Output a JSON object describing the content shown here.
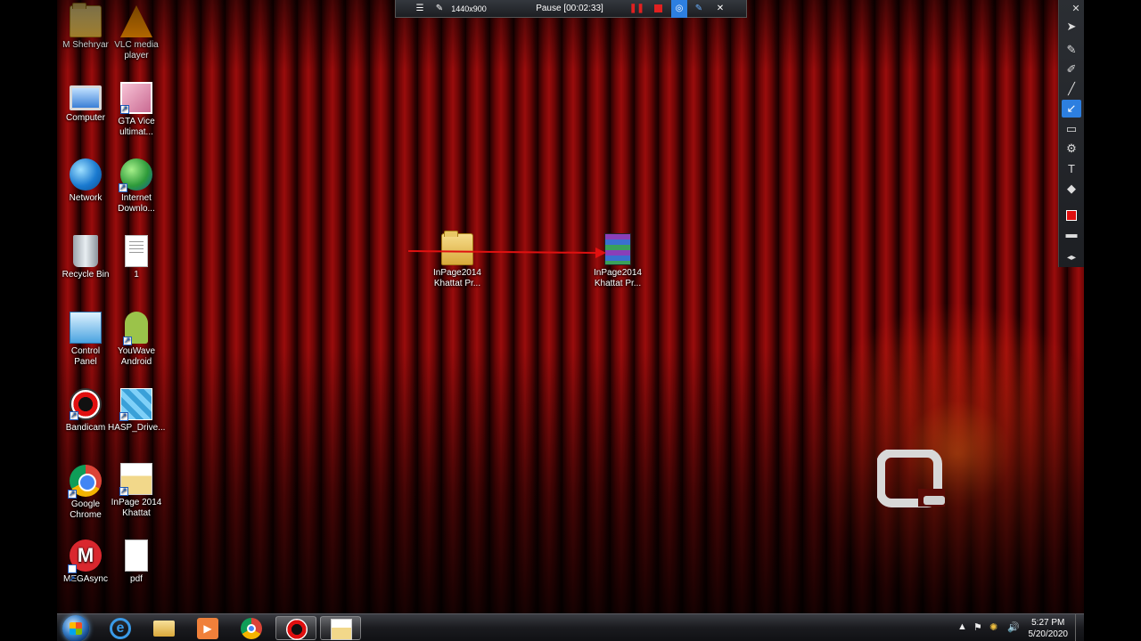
{
  "recorder": {
    "resolution": "1440x900",
    "status": "Pause [00:02:33]",
    "menu_icon": "hamburger-icon",
    "pin_icon": "pin-icon"
  },
  "desktop": {
    "icons_left": [
      {
        "label": "M Shehryar",
        "icon": "user-folder-icon"
      },
      {
        "label": "Computer",
        "icon": "computer-icon"
      },
      {
        "label": "Network",
        "icon": "network-icon"
      },
      {
        "label": "Recycle Bin",
        "icon": "recycle-bin-icon"
      },
      {
        "label": "Control\nPanel",
        "icon": "control-panel-icon"
      },
      {
        "label": "Bandicam",
        "icon": "bandicam-icon"
      },
      {
        "label": "Google\nChrome",
        "icon": "chrome-icon"
      },
      {
        "label": "MEGAsync",
        "icon": "mega-icon"
      }
    ],
    "icons_right": [
      {
        "label": "VLC media\nplayer",
        "icon": "vlc-icon"
      },
      {
        "label": "GTA Vice\nultimat...",
        "icon": "gta-icon"
      },
      {
        "label": "Internet\nDownlo...",
        "icon": "idm-icon"
      },
      {
        "label": "1",
        "icon": "text-document-icon"
      },
      {
        "label": "YouWave\nAndroid",
        "icon": "android-icon"
      },
      {
        "label": "HASP_Drive...",
        "icon": "hasp-icon"
      },
      {
        "label": "InPage 2014\nKhattat",
        "icon": "inpage-icon"
      },
      {
        "label": "pdf",
        "icon": "pdf-document-icon"
      }
    ],
    "center_folder": {
      "label": "InPage2014\nKhattat Pr...",
      "icon": "folder-icon"
    },
    "center_archive": {
      "label": "InPage2014\nKhattat Pr...",
      "icon": "winrar-archive-icon"
    }
  },
  "annotation": {
    "color": "#e01010"
  },
  "draw_tools": [
    "cursor-icon",
    "pen-icon",
    "highlighter-icon",
    "line-icon",
    "arrow-icon",
    "rectangle-icon",
    "numbering-icon",
    "text-icon",
    "eraser-icon",
    "color-swatch-icon",
    "line-width-icon",
    "expand-icon"
  ],
  "taskbar": {
    "apps": [
      "start-button",
      "internet-explorer-icon",
      "file-explorer-icon",
      "media-player-icon",
      "chrome-icon",
      "bandicam-icon",
      "inpage-icon"
    ],
    "clock_time": "5:27 PM",
    "clock_date": "5/20/2020"
  },
  "colors": {
    "accent": "#2d7fe0",
    "record_red": "#e02020"
  }
}
